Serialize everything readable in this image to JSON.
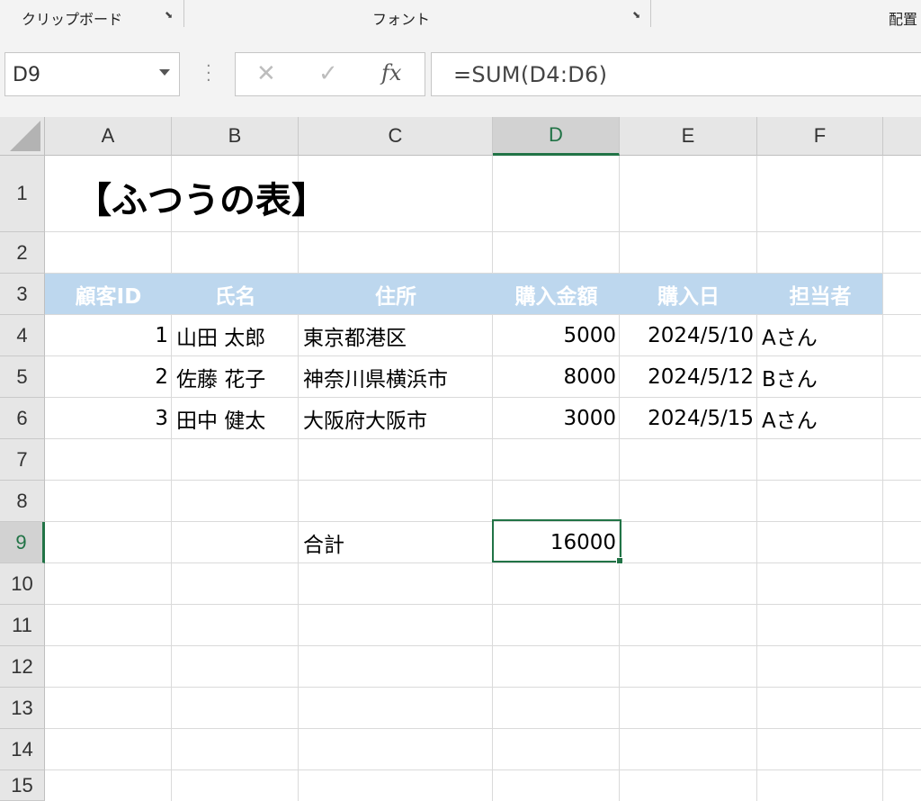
{
  "ribbon": {
    "groups": [
      {
        "label": "クリップボード"
      },
      {
        "label": "フォント"
      },
      {
        "label": "配置"
      }
    ]
  },
  "formula_bar": {
    "name_box": "D9",
    "cancel_glyph": "✕",
    "enter_glyph": "✓",
    "fx_label": "fx",
    "formula": "=SUM(D4:D6)"
  },
  "grid": {
    "columns": [
      "A",
      "B",
      "C",
      "D",
      "E",
      "F"
    ],
    "active_column": "D",
    "rows": [
      "1",
      "2",
      "3",
      "4",
      "5",
      "6",
      "7",
      "8",
      "9",
      "10",
      "11",
      "12",
      "13",
      "14",
      "15"
    ],
    "active_row": "9",
    "title": "【ふつうの表】",
    "table": {
      "headers": [
        "顧客ID",
        "氏名",
        "住所",
        "購入金額",
        "購入日",
        "担当者"
      ],
      "rows": [
        {
          "id": "1",
          "name": "山田 太郎",
          "address": "東京都港区",
          "amount": "5000",
          "date": "2024/5/10",
          "staff": "Aさん"
        },
        {
          "id": "2",
          "name": "佐藤 花子",
          "address": "神奈川県横浜市",
          "amount": "8000",
          "date": "2024/5/12",
          "staff": "Bさん"
        },
        {
          "id": "3",
          "name": "田中 健太",
          "address": "大阪府大阪市",
          "amount": "3000",
          "date": "2024/5/15",
          "staff": "Aさん"
        }
      ]
    },
    "total_label": "合計",
    "total_value": "16000",
    "header_color": "#bdd7ee",
    "accent_color": "#217346"
  }
}
